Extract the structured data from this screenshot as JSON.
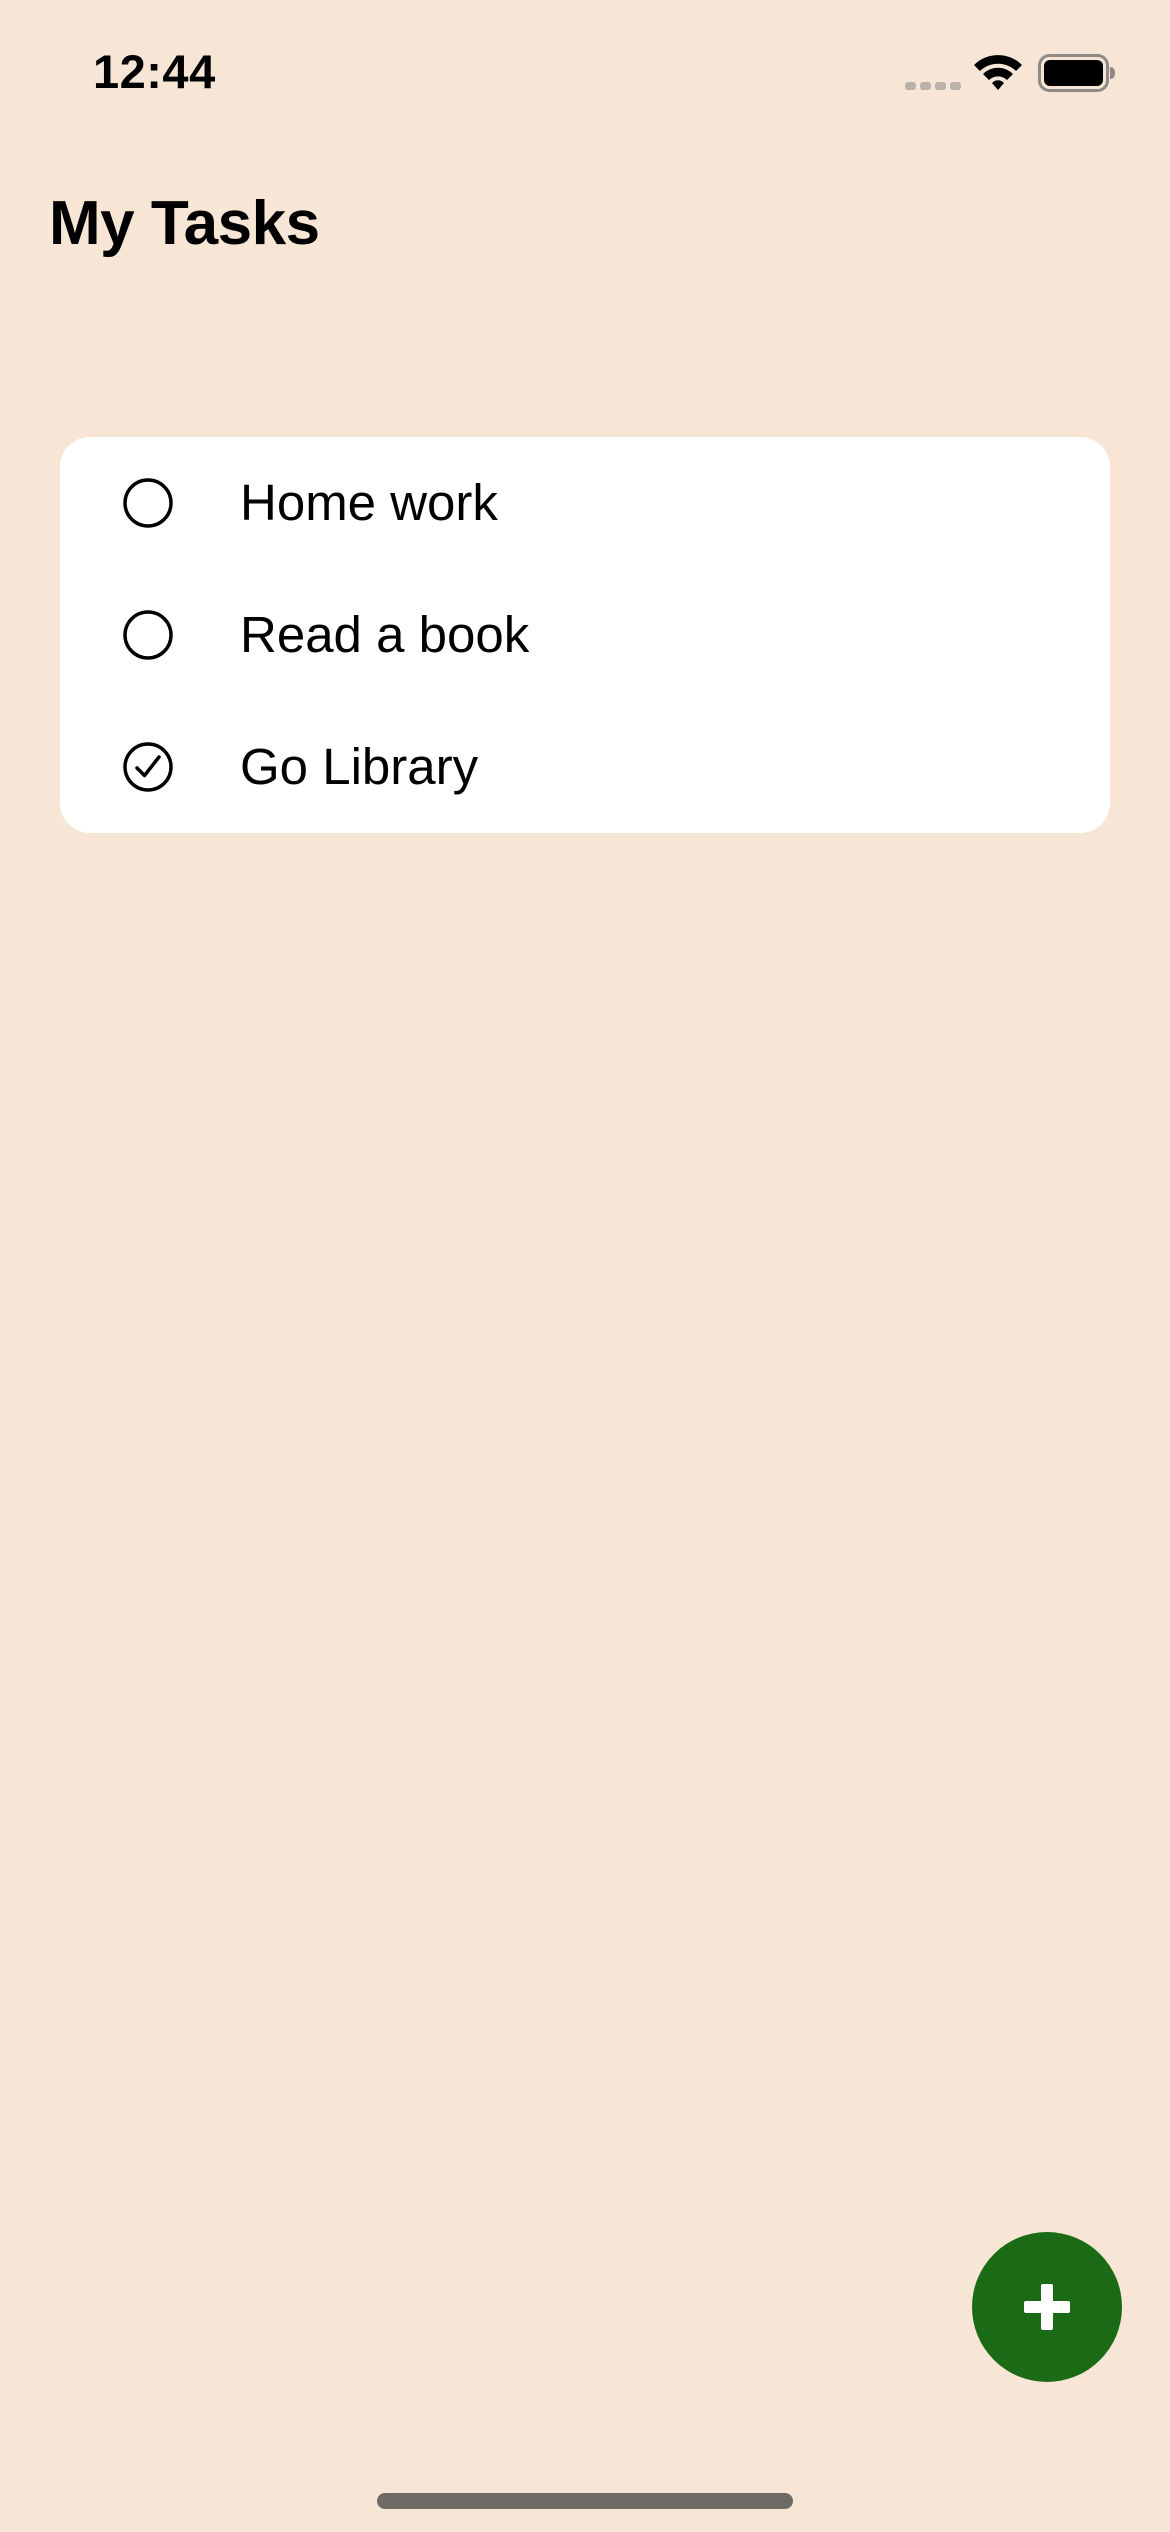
{
  "status_bar": {
    "time": "12:44",
    "signal_icon": "cellular-signal-icon",
    "wifi_icon": "wifi-icon",
    "battery_icon": "battery-icon",
    "battery_level": 1.0
  },
  "header": {
    "title": "My Tasks"
  },
  "tasks": [
    {
      "label": "Home work",
      "completed": false,
      "icon": "circle-unchecked-icon"
    },
    {
      "label": "Read a book",
      "completed": false,
      "icon": "circle-unchecked-icon"
    },
    {
      "label": "Go Library",
      "completed": true,
      "icon": "circle-checkmark-icon"
    }
  ],
  "fab": {
    "icon": "plus-icon"
  },
  "colors": {
    "background": "#f7e6d6",
    "card": "#ffffff",
    "accent": "#1b6a16",
    "text": "#000000"
  }
}
